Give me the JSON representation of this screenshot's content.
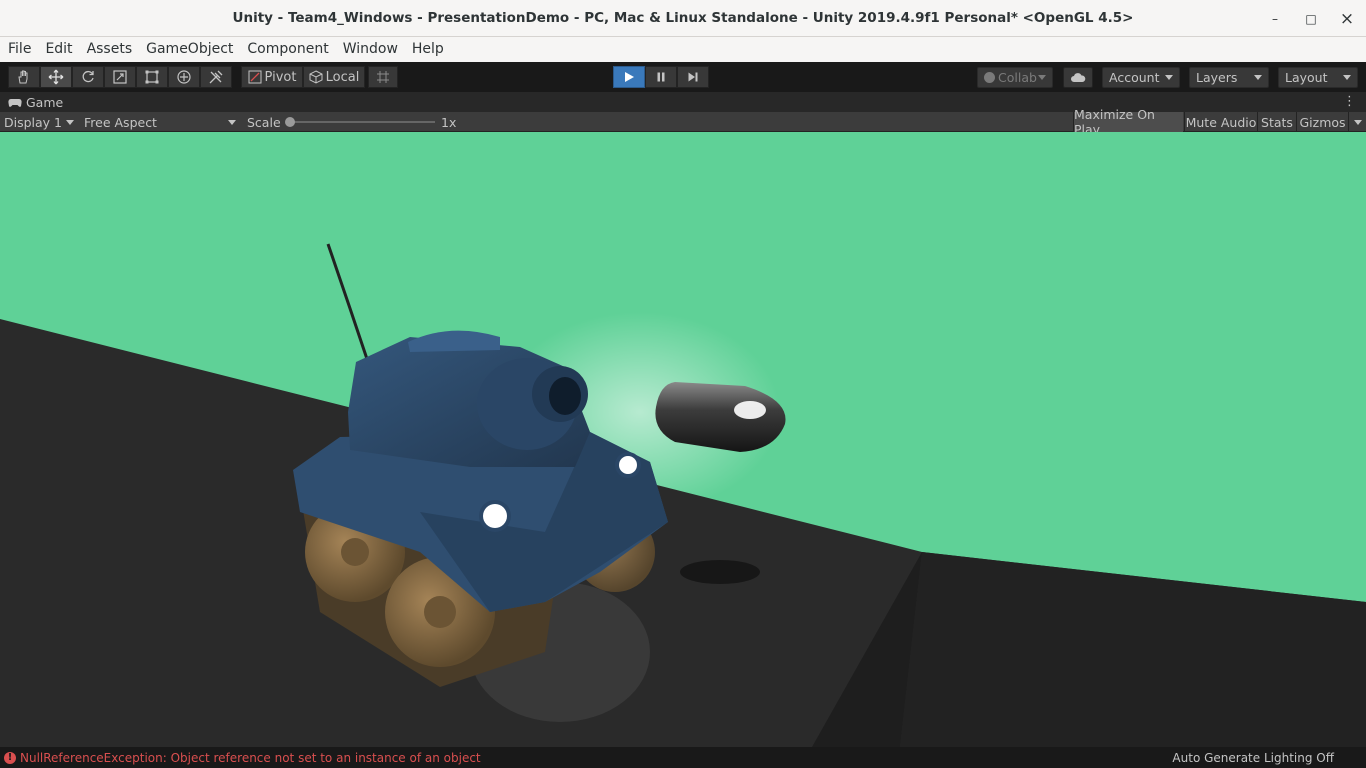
{
  "window": {
    "title": "Unity - Team4_Windows - PresentationDemo - PC, Mac & Linux Standalone - Unity 2019.4.9f1 Personal* <OpenGL 4.5>",
    "minimize": "–",
    "maximize": "□",
    "close": "×"
  },
  "menu": [
    "File",
    "Edit",
    "Assets",
    "GameObject",
    "Component",
    "Window",
    "Help"
  ],
  "toolbar": {
    "tools": [
      "hand-tool",
      "move-tool",
      "rotate-tool",
      "scale-tool",
      "rect-tool",
      "transform-tool",
      "custom-tool"
    ],
    "active_tool": "move-tool",
    "pivot_label": "Pivot",
    "local_label": "Local",
    "collab_label": "Collab",
    "account_label": "Account",
    "layers_label": "Layers",
    "layout_label": "Layout"
  },
  "game_tab": {
    "label": "Game"
  },
  "game_bar": {
    "display": "Display 1",
    "aspect": "Free Aspect",
    "scale_label": "Scale",
    "scale_value": "1x",
    "maximize_on_play": "Maximize On Play",
    "mute_audio": "Mute Audio",
    "stats": "Stats",
    "gizmos": "Gizmos"
  },
  "status": {
    "error": "NullReferenceException: Object reference not set to an instance of an object",
    "lighting": "Auto Generate Lighting Off"
  },
  "colors": {
    "sky": "#5fd197",
    "ground": "#2a2a2a",
    "tank_body": "#2f4e70",
    "tank_wheels": "#8a6d44",
    "bullet": "#4a4a4a",
    "error": "#d94f4f",
    "play_active": "#3a79bb"
  }
}
